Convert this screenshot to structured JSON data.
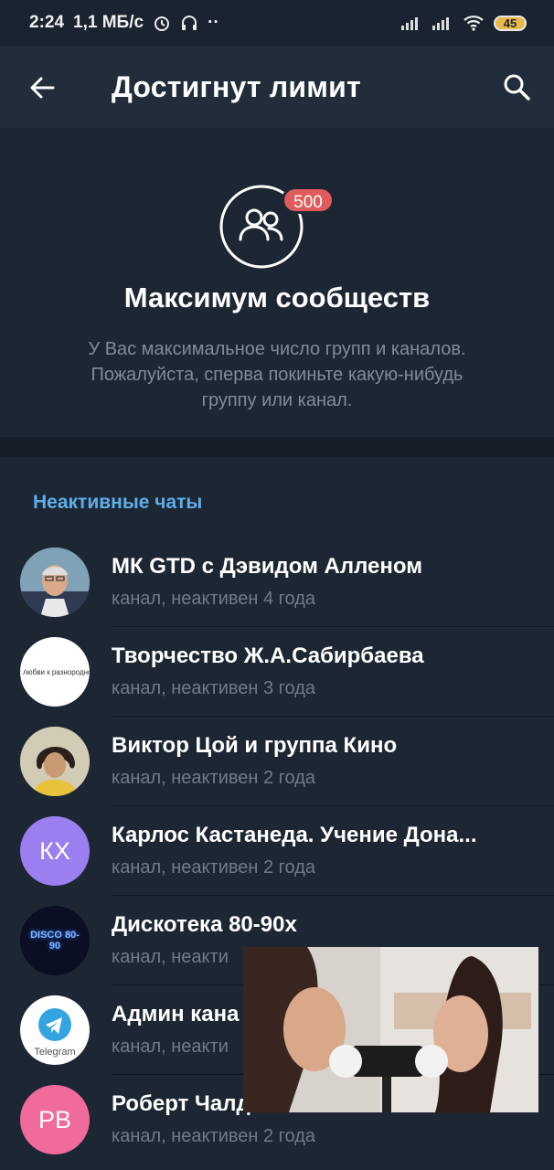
{
  "status_bar": {
    "time": "2:24",
    "speed": "1,1 МБ/с",
    "battery": "45"
  },
  "app_bar": {
    "title": "Достигнут лимит",
    "back_icon": "arrow-left-icon",
    "search_icon": "search-icon"
  },
  "limit": {
    "icon": "community-icon",
    "badge": "500",
    "heading": "Максимум сообществ",
    "description": "У Вас максимальное число групп и каналов. Пожалуйста, сперва покиньте какую-нибудь группу или канал."
  },
  "inactive": {
    "header": "Неактивные чаты",
    "chats": [
      {
        "title": "МК GTD с Дэвидом Алленом",
        "subtitle": "канал, неактивен 4 года"
      },
      {
        "title": "Творчество Ж.А.Сабирбаева",
        "subtitle": "канал, неактивен 3 года",
        "avatar_text": "От любви к разнородно..."
      },
      {
        "title": "Виктор Цой и группа Кино",
        "subtitle": "канал, неактивен 2 года"
      },
      {
        "title": "Карлос Кастанеда. Учение Дона...",
        "subtitle": "канал, неактивен 2 года",
        "initials": "КХ",
        "color": "#9b7ff0"
      },
      {
        "title": "Дискотека 80-90х",
        "subtitle": "канал, неакти",
        "logo_text": "DISCO 80-90"
      },
      {
        "title": "Админ кана",
        "subtitle": "канал, неакти",
        "logo_text": "Telegram"
      },
      {
        "title": "Роберт Чалдини. Психология вл...",
        "subtitle": "канал, неактивен 2 года",
        "initials": "РВ",
        "color": "#f06b9b"
      }
    ]
  },
  "colors": {
    "background": "#1d2733",
    "app_bar": "#212d3b",
    "accent": "#5eaeea",
    "badge": "#e05b5b",
    "secondary_text": "#6e7c8a"
  }
}
